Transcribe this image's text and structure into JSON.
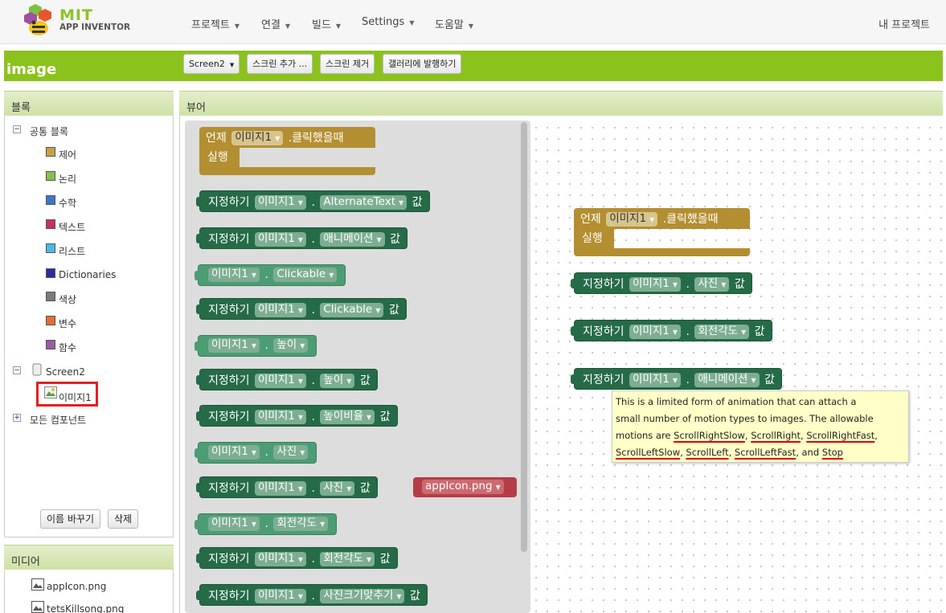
{
  "topbar": {
    "logo_title": "MIT",
    "logo_subtitle": "APP INVENTOR",
    "menus": [
      "프로젝트",
      "연결",
      "빌드",
      "Settings",
      "도움말"
    ],
    "my_projects": "내 프로젝트"
  },
  "project": {
    "name": "image",
    "screen_select": "Screen2",
    "buttons": [
      "스크린 추가 ...",
      "스크린 제거",
      "갤러리에 발행하기"
    ]
  },
  "blocks_panel": {
    "header": "블록",
    "builtin_label": "공통 블록",
    "builtin_items": [
      {
        "label": "제어",
        "color": "#c8a046"
      },
      {
        "label": "논리",
        "color": "#86c04a"
      },
      {
        "label": "수학",
        "color": "#3d76c4"
      },
      {
        "label": "텍스트",
        "color": "#c8305a"
      },
      {
        "label": "리스트",
        "color": "#4fb7e4"
      },
      {
        "label": "Dictionaries",
        "color": "#2a2d9c"
      },
      {
        "label": "색상",
        "color": "#7b7b7b"
      },
      {
        "label": "변수",
        "color": "#e06e35"
      },
      {
        "label": "함수",
        "color": "#9a5aa6"
      }
    ],
    "screen_label": "Screen2",
    "component_label": "이미지1",
    "any_component_label": "모든 컴포넌트",
    "rename_button": "이름 바꾸기",
    "delete_button": "삭제"
  },
  "media_panel": {
    "header": "미디어",
    "items": [
      "appIcon.png",
      "tetsKillsong.png"
    ]
  },
  "viewer": {
    "header": "뷰어"
  },
  "blocks": {
    "when": "언제",
    "clicked": ".클릭했을때",
    "do": "실행",
    "set": "지정하기",
    "value": "값",
    "component": "이미지1",
    "dot": ".",
    "alternate_text": "AlternateText",
    "animation": "애니메이션",
    "clickable": "Clickable",
    "height": "높이",
    "height_percent": "높이비율",
    "picture": "사진",
    "rotation": "회전각도",
    "scale_picture": "사진크기맞추기",
    "picture_value": "appIcon.png"
  },
  "tooltip": {
    "line1": "This is a limited form of animation that can attach a",
    "line2": "small number of motion types to images. The allowable",
    "line3_prefix": "motions are ",
    "scroll_right_slow": "ScrollRightSlow",
    "scroll_right": "ScrollRight",
    "scroll_right_fast": "ScrollRightFast",
    "scroll_left_slow": "ScrollLeftSlow",
    "scroll_left": "ScrollLeft",
    "scroll_left_fast": "ScrollLeftFast",
    "and": "and",
    "stop": "Stop"
  }
}
